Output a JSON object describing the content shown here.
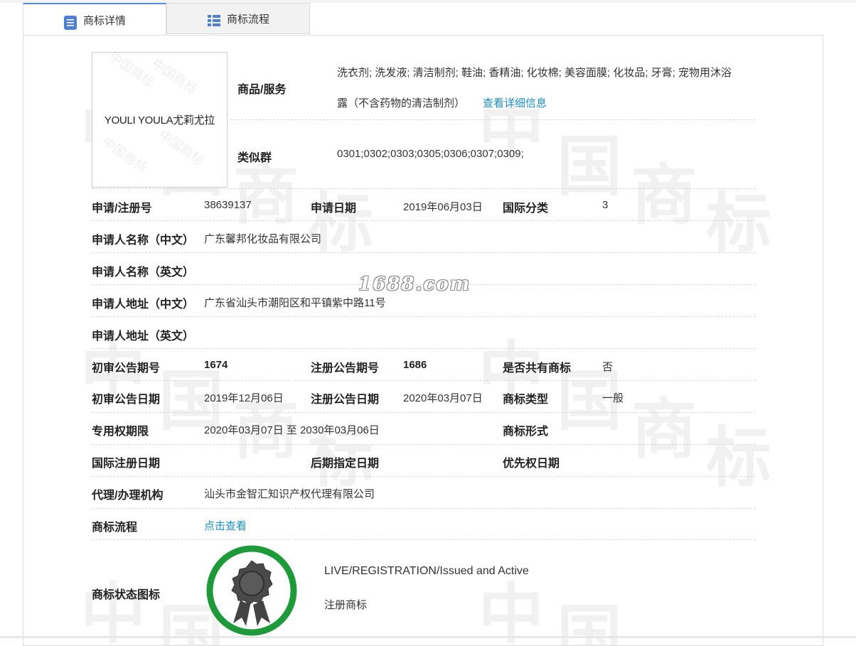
{
  "tabs": [
    {
      "label": "商标详情",
      "icon": "list-doc-icon",
      "active": true
    },
    {
      "label": "商标流程",
      "icon": "grid-list-icon",
      "active": false
    }
  ],
  "logo": {
    "text": "YOULI YOULA尤莉尤拉"
  },
  "goods": {
    "label": "商品/服务",
    "value_line1": "洗衣剂; 洗发液; 清洁制剂; 鞋油; 香精油; 化妆棉; 美容面膜; 化妆品; 牙膏; 宠物用沐浴",
    "value_line2": "露（不含药物的清洁制剂）",
    "link": "查看详细信息"
  },
  "similar": {
    "label": "类似群",
    "value": "0301;0302;0303;0305;0306;0307;0309;"
  },
  "rows": {
    "reg_no_label": "申请/注册号",
    "reg_no": "38639137",
    "apply_date_label": "申请日期",
    "apply_date": "2019年06月03日",
    "intl_class_label": "国际分类",
    "intl_class": "3",
    "applicant_cn_label": "申请人名称（中文）",
    "applicant_cn": "广东馨邦化妆品有限公司",
    "applicant_en_label": "申请人名称（英文）",
    "applicant_en": "",
    "addr_cn_label": "申请人地址（中文）",
    "addr_cn": "广东省汕头市潮阳区和平镇紫中路11号",
    "addr_en_label": "申请人地址（英文）",
    "addr_en": "",
    "prelim_no_label": "初审公告期号",
    "prelim_no": "1674",
    "reg_notice_no_label": "注册公告期号",
    "reg_notice_no": "1686",
    "shared_label": "是否共有商标",
    "shared": "否",
    "prelim_date_label": "初审公告日期",
    "prelim_date": "2019年12月06日",
    "reg_notice_date_label": "注册公告日期",
    "reg_notice_date": "2020年03月07日",
    "tm_type_label": "商标类型",
    "tm_type": "一般",
    "exclusive_label": "专用权期限",
    "exclusive": "2020年03月07日 至 2030年03月06日",
    "tm_form_label": "商标形式",
    "tm_form": "",
    "intl_reg_date_label": "国际注册日期",
    "intl_reg_date": "",
    "later_date_label": "后期指定日期",
    "later_date": "",
    "priority_label": "优先权日期",
    "priority": "",
    "agent_label": "代理/办理机构",
    "agent": "汕头市金智汇知识产权代理有限公司",
    "flow_label": "商标流程",
    "flow_link": "点击查看",
    "status_icon_label": "商标状态图标",
    "status_en": "LIVE/REGISTRATION/Issued and Active",
    "status_cn": "注册商标"
  },
  "watermark": {
    "site": "1688.com",
    "bg_chars": [
      "中",
      "国",
      "商",
      "标"
    ]
  },
  "colors": {
    "link": "#1b8fc7",
    "seal_ring": "#1f9a3a",
    "tab_accent": "#5b8bd8"
  }
}
